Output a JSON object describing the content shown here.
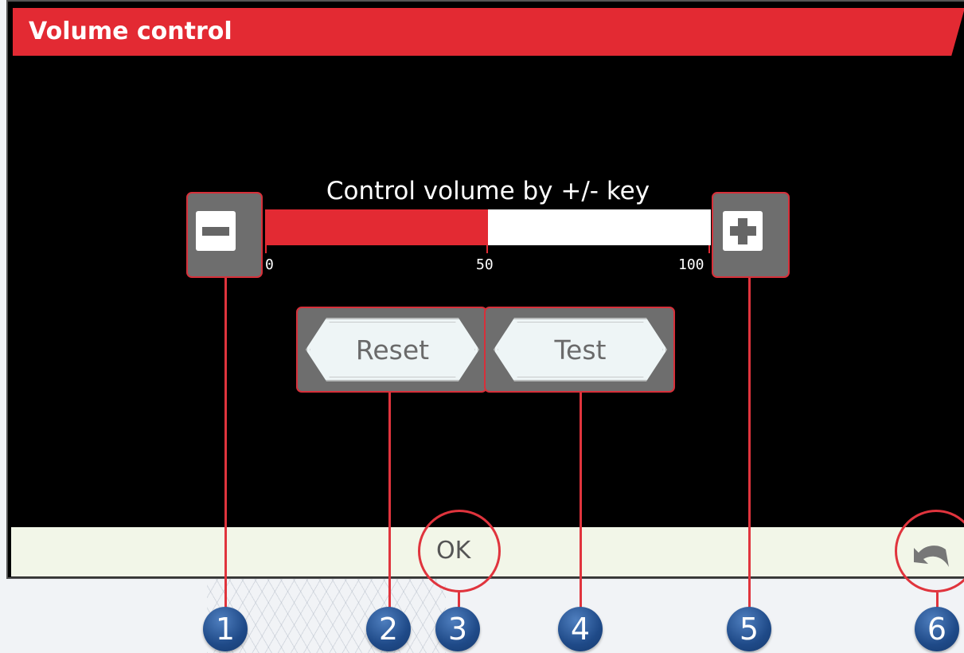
{
  "title": "Volume control",
  "caption": "Control volume by +/- key",
  "volume": {
    "value": 50,
    "min": 0,
    "max": 100,
    "ticks": [
      "0",
      "50",
      "100"
    ]
  },
  "buttons": {
    "reset": "Reset",
    "test": "Test",
    "ok": "OK"
  },
  "icons": {
    "decrease": "minus-icon",
    "increase": "plus-icon",
    "back": "undo-arrow-icon"
  },
  "callouts": [
    "1",
    "2",
    "3",
    "4",
    "5",
    "6"
  ],
  "colors": {
    "accent": "#e32a33",
    "screen_bg": "#000000",
    "button_frame": "#6e6e6e",
    "badge": "#1f4a88",
    "bottom_bar": "#f2f6e8"
  }
}
